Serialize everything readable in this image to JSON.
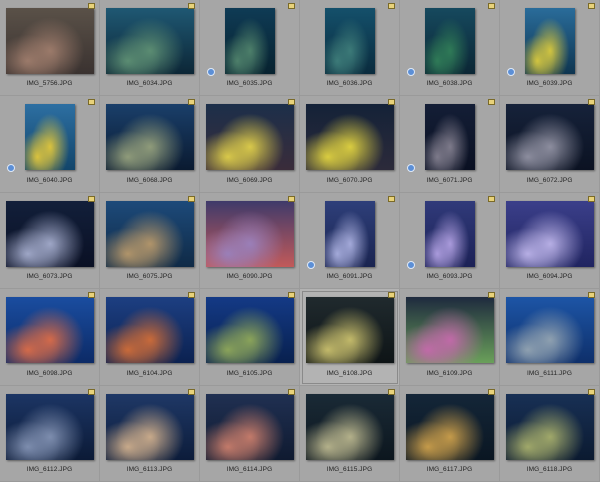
{
  "thumbnails": [
    {
      "name": "IMG_5756.JPG",
      "orient": "land",
      "c1": "#5a5148",
      "c2": "#9b7a6a",
      "c3": "#3a3230",
      "rotate": false
    },
    {
      "name": "IMG_6034.JPG",
      "orient": "land",
      "c1": "#1f5873",
      "c2": "#5b8c72",
      "c3": "#0c2636",
      "rotate": false
    },
    {
      "name": "IMG_6035.JPG",
      "orient": "port",
      "c1": "#0f3b55",
      "c2": "#4d7f6a",
      "c3": "#07222f",
      "rotate": true
    },
    {
      "name": "IMG_6036.JPG",
      "orient": "port",
      "c1": "#14506b",
      "c2": "#3c7a78",
      "c3": "#0a2b3d",
      "rotate": false
    },
    {
      "name": "IMG_6038.JPG",
      "orient": "port",
      "c1": "#16495e",
      "c2": "#2f7a57",
      "c3": "#0b2634",
      "rotate": true
    },
    {
      "name": "IMG_6039.JPG",
      "orient": "port",
      "c1": "#2a6c9a",
      "c2": "#d1c440",
      "c3": "#0e3550",
      "rotate": true
    },
    {
      "name": "IMG_6040.JPG",
      "orient": "port",
      "c1": "#2d6fa2",
      "c2": "#d9c23e",
      "c3": "#12456a",
      "rotate": true
    },
    {
      "name": "IMG_6068.JPG",
      "orient": "land",
      "c1": "#1a3f6a",
      "c2": "#8f9b7a",
      "c3": "#0a1a30",
      "rotate": false
    },
    {
      "name": "IMG_6069.JPG",
      "orient": "land",
      "c1": "#1c2f4a",
      "c2": "#d8c84a",
      "c3": "#3a2c3a",
      "rotate": false
    },
    {
      "name": "IMG_6070.JPG",
      "orient": "land",
      "c1": "#142238",
      "c2": "#d9cc40",
      "c3": "#2c2a3a",
      "rotate": false
    },
    {
      "name": "IMG_6071.JPG",
      "orient": "port",
      "c1": "#141e36",
      "c2": "#7d7a8a",
      "c3": "#0a1022",
      "rotate": true
    },
    {
      "name": "IMG_6072.JPG",
      "orient": "land",
      "c1": "#16223a",
      "c2": "#8c8d9e",
      "c3": "#0b1222",
      "rotate": false
    },
    {
      "name": "IMG_6073.JPG",
      "orient": "land",
      "c1": "#121f3a",
      "c2": "#9ea6c6",
      "c3": "#0a1024",
      "rotate": false
    },
    {
      "name": "IMG_6075.JPG",
      "orient": "land",
      "c1": "#1d4a7a",
      "c2": "#b0946a",
      "c3": "#0f2a46",
      "rotate": false
    },
    {
      "name": "IMG_6090.JPG",
      "orient": "land",
      "c1": "#3f3a6a",
      "c2": "#9a7fb8",
      "c3": "#c25a5a",
      "rotate": false
    },
    {
      "name": "IMG_6091.JPG",
      "orient": "port",
      "c1": "#2e3f7a",
      "c2": "#a3a9d9",
      "c3": "#1a2450",
      "rotate": true
    },
    {
      "name": "IMG_6093.JPG",
      "orient": "port",
      "c1": "#303a7a",
      "c2": "#a99adb",
      "c3": "#1c2156",
      "rotate": true
    },
    {
      "name": "IMG_6094.JPG",
      "orient": "land",
      "c1": "#3b3f8a",
      "c2": "#b6aee4",
      "c3": "#202460",
      "rotate": false
    },
    {
      "name": "IMG_6098.JPG",
      "orient": "land",
      "c1": "#1a4da0",
      "c2": "#d36a4a",
      "c3": "#0c2a66",
      "rotate": false
    },
    {
      "name": "IMG_6104.JPG",
      "orient": "land",
      "c1": "#1d3f82",
      "c2": "#c86a3a",
      "c3": "#0b2150",
      "rotate": false
    },
    {
      "name": "IMG_6105.JPG",
      "orient": "land",
      "c1": "#143a86",
      "c2": "#8aa35a",
      "c3": "#08204e",
      "rotate": false
    },
    {
      "name": "IMG_6108.JPG",
      "orient": "land",
      "c1": "#202a2e",
      "c2": "#c2b96a",
      "c3": "#0e1416",
      "rotate": false
    },
    {
      "name": "IMG_6109.JPG",
      "orient": "land",
      "c1": "#1e2a3e",
      "c2": "#c06aa8",
      "c3": "#6aa05a",
      "rotate": false
    },
    {
      "name": "IMG_6111.JPG",
      "orient": "land",
      "c1": "#1d55a6",
      "c2": "#8ea0b0",
      "c3": "#0e2f6a",
      "rotate": false
    },
    {
      "name": "IMG_6112.JPG",
      "orient": "land",
      "c1": "#1c3564",
      "c2": "#7d8dae",
      "c3": "#0b1a36",
      "rotate": false
    },
    {
      "name": "IMG_6113.JPG",
      "orient": "land",
      "c1": "#1f3866",
      "c2": "#c7a98a",
      "c3": "#0c1c3a",
      "rotate": false
    },
    {
      "name": "IMG_6114.JPG",
      "orient": "land",
      "c1": "#203052",
      "c2": "#c27a6a",
      "c3": "#0f1a30",
      "rotate": false
    },
    {
      "name": "IMG_6115.JPG",
      "orient": "land",
      "c1": "#1a2a36",
      "c2": "#b3b08a",
      "c3": "#0c161e",
      "rotate": false
    },
    {
      "name": "IMG_6117.JPG",
      "orient": "land",
      "c1": "#142638",
      "c2": "#c49a4a",
      "c3": "#0a1622",
      "rotate": false
    },
    {
      "name": "IMG_6118.JPG",
      "orient": "land",
      "c1": "#183055",
      "c2": "#a0a86a",
      "c3": "#0b1a30",
      "rotate": false
    }
  ],
  "selected_index": 21
}
